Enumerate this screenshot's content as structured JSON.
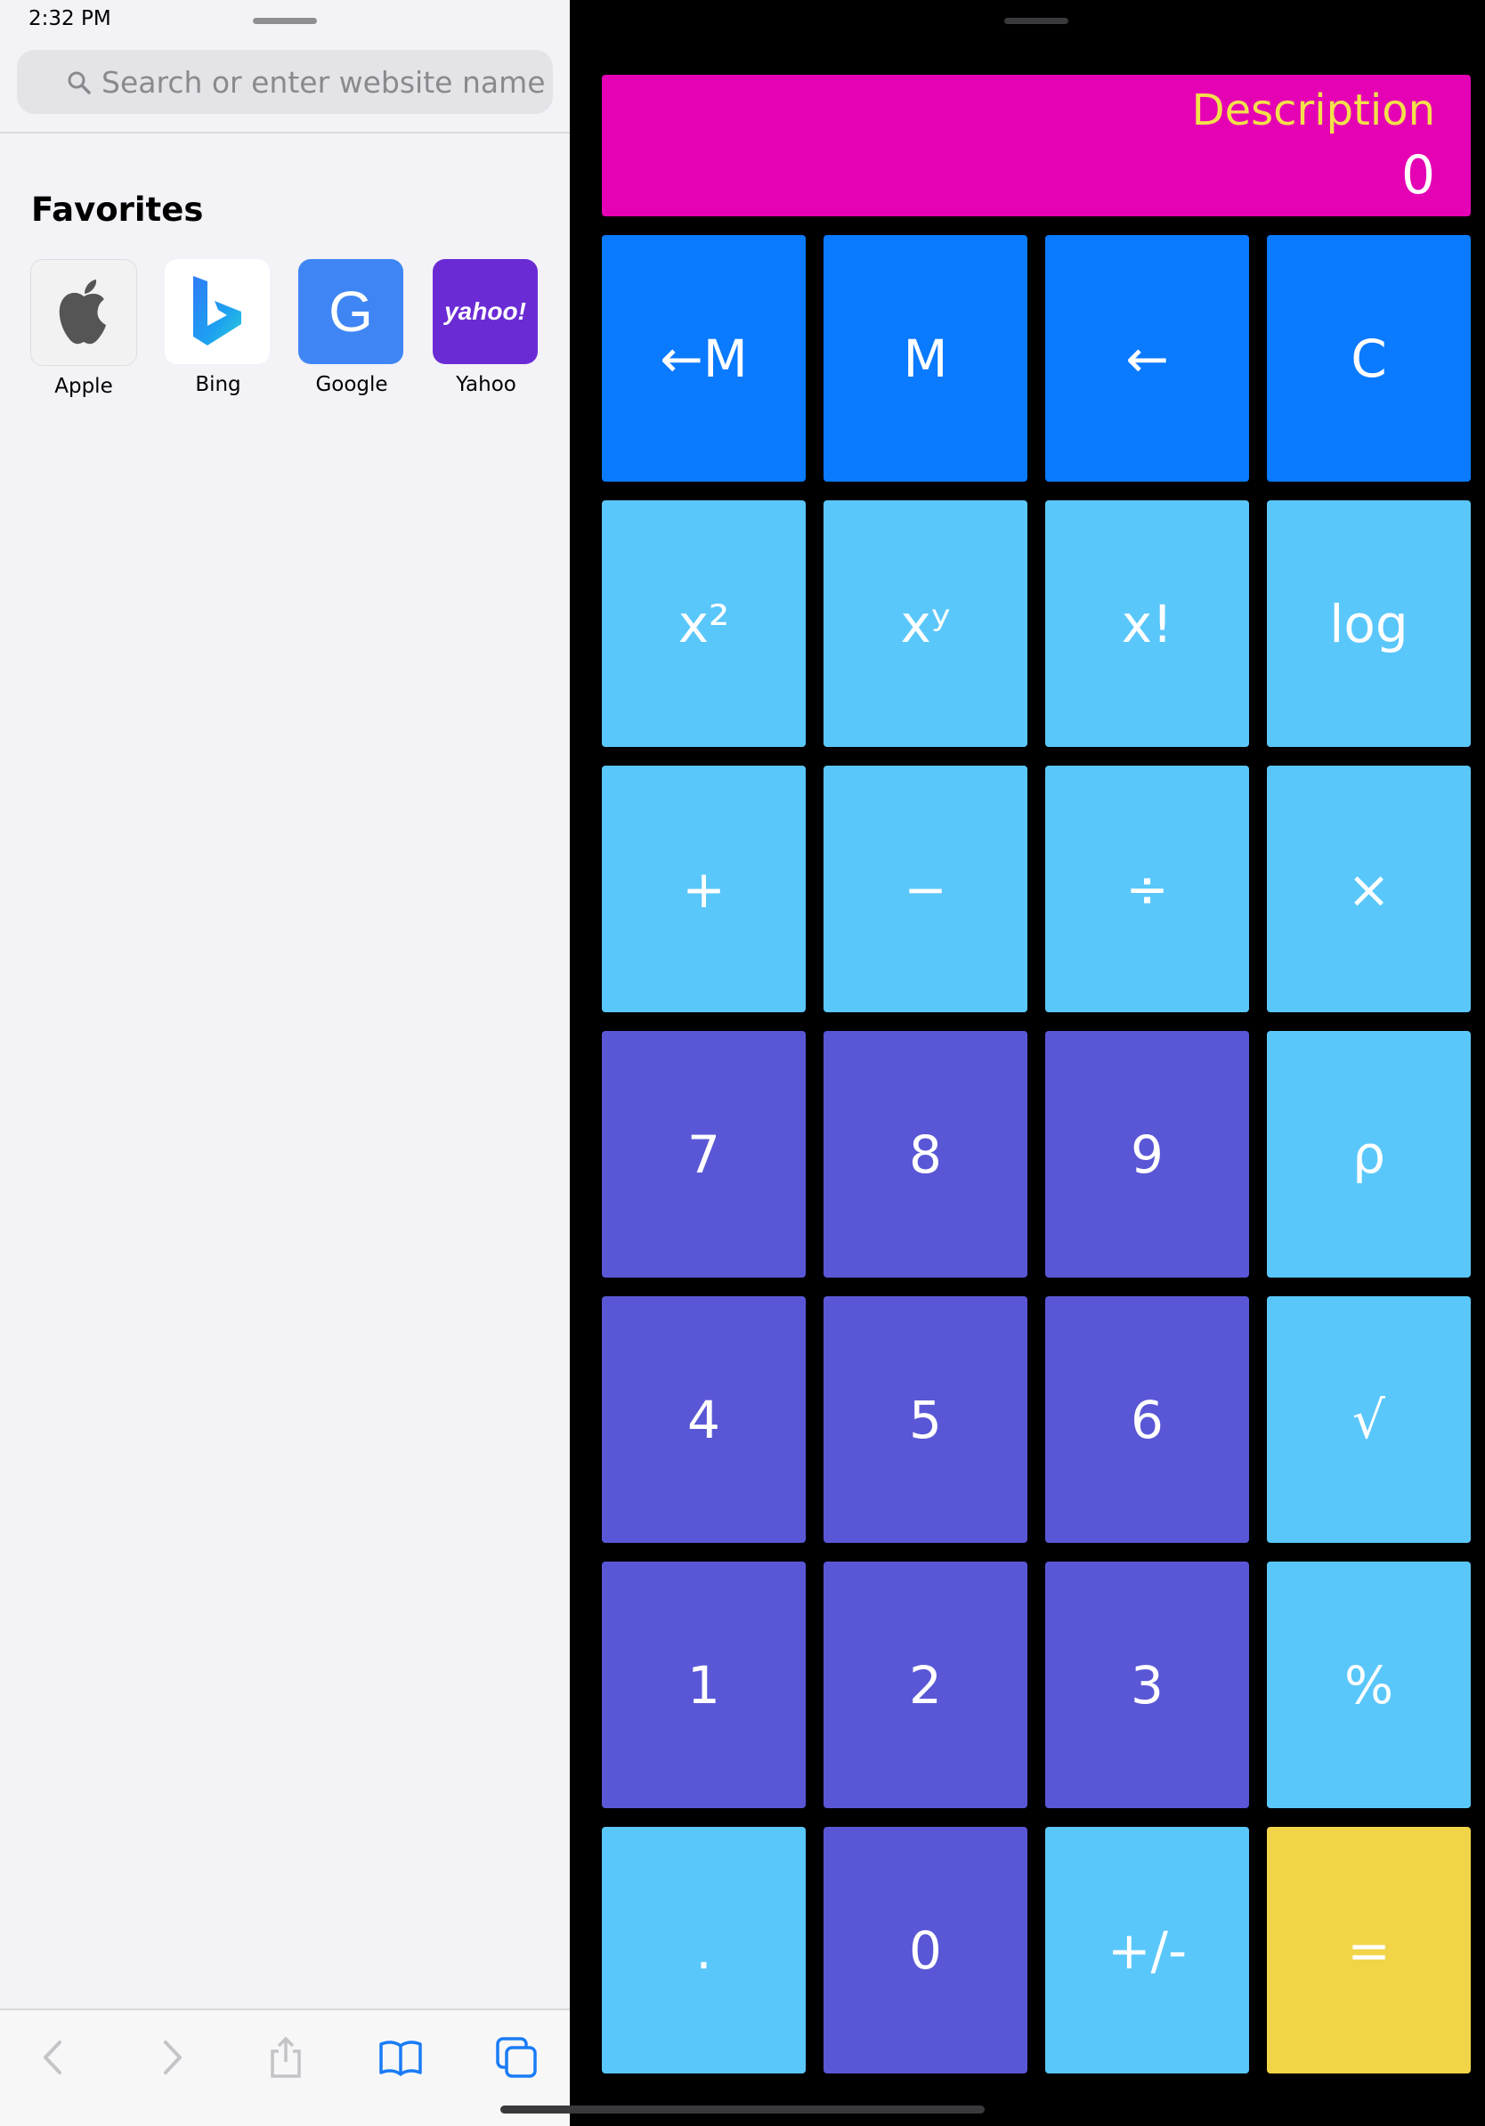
{
  "status_bar": {
    "time": "2:32 PM"
  },
  "browser": {
    "search": {
      "placeholder": "Search or enter website name"
    },
    "favorites": {
      "title": "Favorites",
      "items": [
        {
          "label": "Apple",
          "icon": "apple-logo-icon",
          "color": "#f2f2f2"
        },
        {
          "label": "Bing",
          "icon": "bing-logo-icon",
          "color": "#ffffff"
        },
        {
          "label": "Google",
          "icon": "google-letter-icon",
          "letter": "G",
          "color": "#3f86f4"
        },
        {
          "label": "Yahoo",
          "icon": "yahoo-logo-icon",
          "wordmark": "yahoo!",
          "color": "#6a2bd4"
        }
      ]
    },
    "toolbar": {
      "icons": [
        "back-icon",
        "forward-icon",
        "share-icon",
        "bookmarks-icon",
        "tabs-icon"
      ]
    }
  },
  "calculator": {
    "display": {
      "description": "Description",
      "value": "0",
      "background": "#e501b4"
    },
    "colors": {
      "blue": "#0a7aff",
      "sky": "#5ac7fa",
      "purple": "#5a57d6",
      "yellow": "#f2d448"
    },
    "keys": [
      [
        "←M",
        "M",
        "←",
        "C"
      ],
      [
        "x²",
        "xʸ",
        "x!",
        "log"
      ],
      [
        "+",
        "−",
        "÷",
        "×"
      ],
      [
        "7",
        "8",
        "9",
        "ρ"
      ],
      [
        "4",
        "5",
        "6",
        "√"
      ],
      [
        "1",
        "2",
        "3",
        "%"
      ],
      [
        ".",
        "0",
        "+/-",
        "="
      ]
    ]
  }
}
